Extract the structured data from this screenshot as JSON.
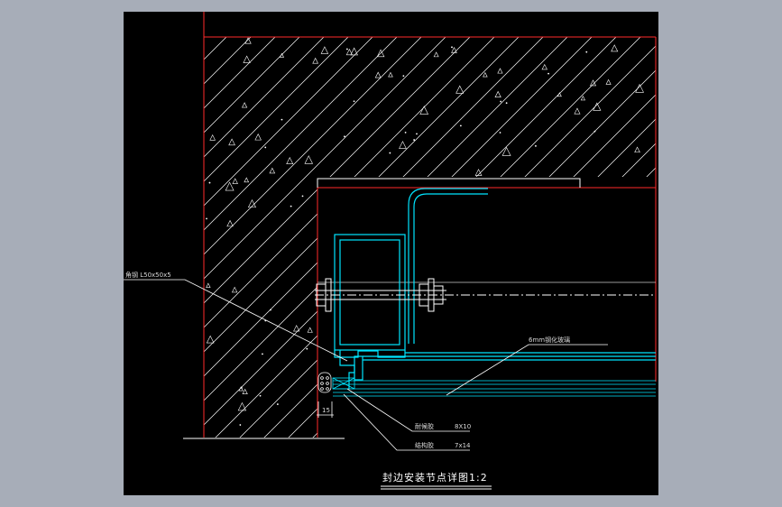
{
  "drawing": {
    "title": "封边安装节点详图1:2",
    "labels": {
      "steel_angle": "角钢 L50x50x5",
      "glass": "6mm钢化玻璃",
      "sealant_1": "耐候胶",
      "sealant_1_spec": "8X10",
      "sealant_2": "结构胶",
      "sealant_2_spec": "7x14",
      "dimension": "15"
    }
  },
  "colors": {
    "background": "#000000",
    "window_frame": "#a7adb8",
    "concrete_outline": "#ff2a2a",
    "steel_profile": "#00e5ff",
    "leader_lines": "#ffffff",
    "hatch": "#ffffff"
  }
}
